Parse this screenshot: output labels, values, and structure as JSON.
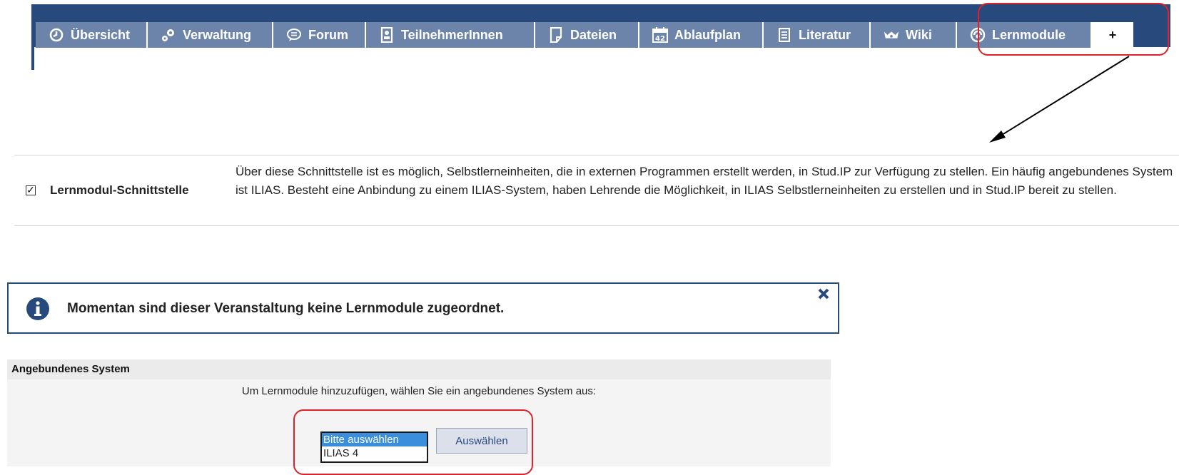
{
  "tabs": [
    {
      "label": "Übersicht",
      "icon": "overview-icon"
    },
    {
      "label": "Verwaltung",
      "icon": "gears-icon"
    },
    {
      "label": "Forum",
      "icon": "speech-bubble-icon"
    },
    {
      "label": "TeilnehmerInnen",
      "icon": "person-card-icon"
    },
    {
      "label": "Dateien",
      "icon": "file-icon"
    },
    {
      "label": "Ablaufplan",
      "icon": "calendar-icon"
    },
    {
      "label": "Literatur",
      "icon": "document-icon"
    },
    {
      "label": "Wiki",
      "icon": "wiki-icon"
    },
    {
      "label": "Lernmodule",
      "icon": "learning-module-icon"
    },
    {
      "label": "+",
      "icon": ""
    }
  ],
  "module": {
    "checked": true,
    "name": "Lernmodul-Schnittstelle",
    "description": "Über diese Schnittstelle ist es möglich, Selbstlerneinheiten, die in externen Programmen erstellt werden, in Stud.IP zur Verfügung zu stellen. Ein häufig angebundenes System ist ILIAS. Besteht eine Anbindung zu einem ILIAS-System, haben Lehrende die Möglichkeit, in ILIAS Selbstlerneinheiten zu erstellen und in Stud.IP bereit zu stellen."
  },
  "info": {
    "message": "Momentan sind dieser Veranstaltung keine Lernmodule zugeordnet."
  },
  "system_panel": {
    "title": "Angebundenes System",
    "hint": "Um Lernmodule hinzuzufügen, wählen Sie ein angebundenes System aus:",
    "options": [
      "Bitte auswählen",
      "ILIAS 4"
    ],
    "selected": "Bitte auswählen",
    "button_label": "Auswählen"
  },
  "colors": {
    "nav": "#28497c",
    "tab": "#6c84a9",
    "highlight": "#e0202a",
    "selected_option": "#3a8edb"
  }
}
